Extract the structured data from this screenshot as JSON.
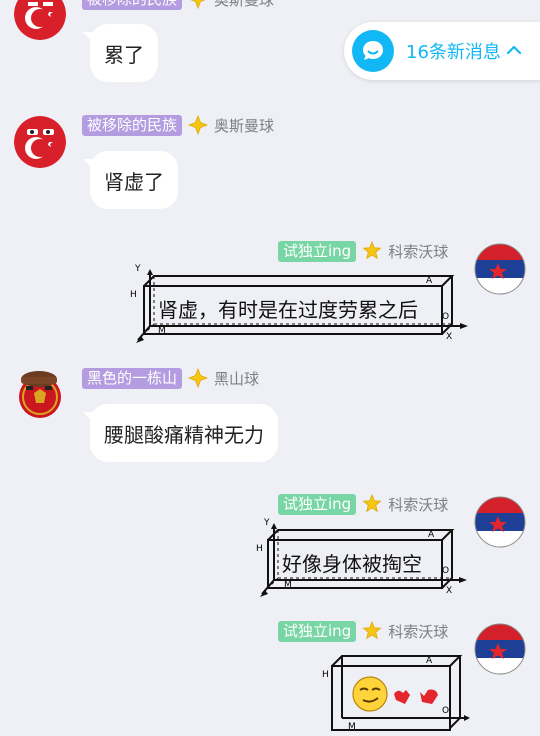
{
  "new_messages": {
    "label": "16条新消息"
  },
  "messages": [
    {
      "tag": "被移除的民族",
      "title": "奥斯曼球",
      "text": "累了"
    },
    {
      "tag": "被移除的民族",
      "title": "奥斯曼球",
      "text": "肾虚了"
    },
    {
      "tag": "试独立ing",
      "title": "科索沃球",
      "text": "肾虚，有时是在过度劳累之后"
    },
    {
      "tag": "黑色的一栋山",
      "title": "黑山球",
      "text": "腰腿酸痛精神无力"
    },
    {
      "tag": "试独立ing",
      "title": "科索沃球",
      "text": "好像身体被掏空"
    },
    {
      "tag": "试独立ing",
      "title": "科索沃球",
      "text": ""
    }
  ],
  "box_axis": {
    "y": "Y",
    "h": "H",
    "m": "M",
    "a": "A",
    "o": "O",
    "x": "X"
  },
  "colors": {
    "accent": "#12b7f5",
    "tag_purple": "#b39ce0",
    "tag_green": "#78d6a4"
  },
  "icons": [
    "chat-bubble-icon",
    "chevron-up-icon",
    "star-badge-icon",
    "emoji-icon"
  ]
}
